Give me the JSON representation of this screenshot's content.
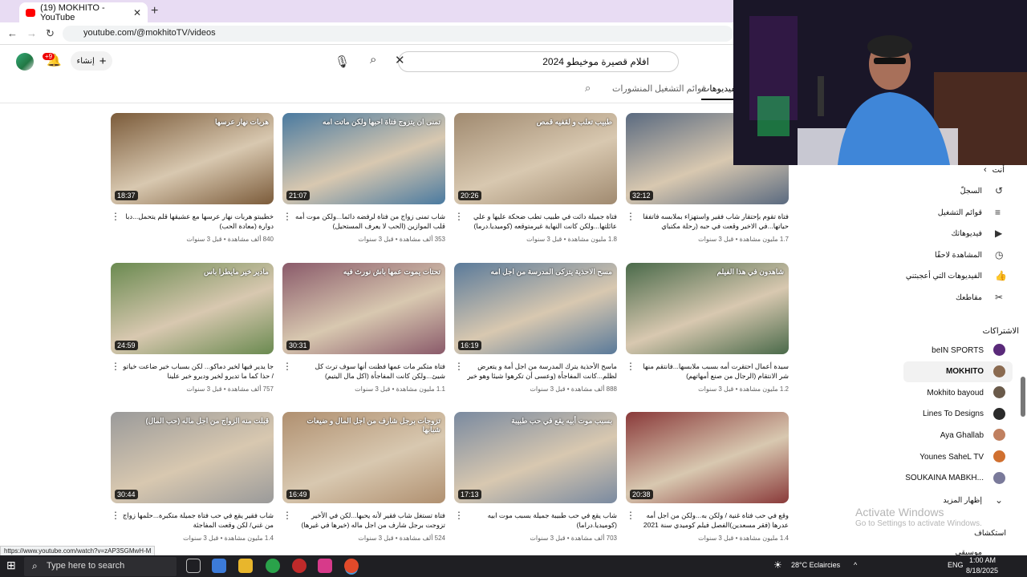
{
  "browser": {
    "tab_title": "(19) MOKHITO - YouTube",
    "url": "youtube.com/@mokhitoTV/videos",
    "status_url": "https://www.youtube.com/watch?v=zAP3SGMwH-M"
  },
  "header": {
    "search_value": "افلام قصيرة موخيطو 2024",
    "create_label": "إنشاء",
    "notif_badge": "+9"
  },
  "tabs": [
    "الفيديوهات",
    "قوائم التشغيل",
    "المنشورات"
  ],
  "videos": [
    {
      "thumb": "هربات نهار عرسها",
      "dur": "18:37",
      "title": "خطيبتو هربات نهار عرسها مع عشيقها قلم يتحمل...دبا دوارة (معادة الحب)",
      "meta": "840 ألف مشاهدة • قبل 3 سنوات",
      "c": "#7b5b3a"
    },
    {
      "thumb": "تمنى ان يتزوج فتاة احبها ولكن ماتت امه",
      "dur": "21:07",
      "title": "شاب تمنى زواج من فتاة لرفضه دائما...ولكن موت أمه قلب الموازين (الحب لا يعرف المستحيل)",
      "meta": "353 ألف مشاهدة • قبل 3 سنوات",
      "c": "#4a7aa0"
    },
    {
      "thumb": "طبيب تعلب و لقفيه قمص",
      "dur": "20:26",
      "title": "فتاة جميلة دائت في طبيب تطب ضحكة عليها و علي عائلتها...ولكن كانت النهاية غيرمتوقعه (كوميديا.درما)",
      "meta": "1.8 مليون مشاهدة • قبل 3 سنوات",
      "c": "#a08a70"
    },
    {
      "thumb": "",
      "dur": "32:12",
      "title": "فتاة تقوم بإحتقار شاب فقير واستهزاء بملابسه فاتفقا حياتها...في الاخير وقعت في حبه (رحلة مكتباي مكتشرا)",
      "meta": "1.7 مليون مشاهدة • قبل 3 سنوات",
      "c": "#5a6a80"
    },
    {
      "thumb": "مادير خير مايطرا باس",
      "dur": "24:59",
      "title": "جا يدير فيها لخير دماكو... لكن بسباب خير ضاعت خياتو / حذا كما ما تديرو لخير وديرو خير علينا",
      "meta": "757 ألف مشاهدة • قبل 3 سنوات",
      "c": "#6a8a50"
    },
    {
      "thumb": "تحتات يموت عمها باش نورث فيه",
      "dur": "30:31",
      "title": "فتاة متكبر مات عمها فظنت أنها سوف ترث كل شيئ...ولكن كانت المفاجأة (اكل مال اليتيم)",
      "meta": "1.1 مليون مشاهدة • قبل 3 سنوات",
      "c": "#8a5a6a"
    },
    {
      "thumb": "مسح الاحذية يتزكى المدرسة من اجل امه",
      "dur": "16:19",
      "title": "ماسح الأحذية يترك المدرسة من اجل أمة و يتعرض لظلم...كانت المفاجأة (وعسى أن تكرهوا شيئا وهو خير لكم)",
      "meta": "888 ألف مشاهدة • قبل 3 سنوات",
      "c": "#5a7a9a"
    },
    {
      "thumb": "شاهدون في هذا الفيلم",
      "dur": "",
      "title": "سيدة أعمال احتقرت أمه بسبب ملابسها...فانتقم منها شر الانتقام (الرجال من صنع أمهاتهم)",
      "meta": "1.2 مليون مشاهدة • قبل 3 سنوات",
      "c": "#4a6a4a"
    },
    {
      "thumb": "قبلت منه الزواج من اجل ماله (حب المال)",
      "dur": "30:44",
      "title": "شاب فقير يقع في حب فتاة جميلة متكبرة...حلمها زواج من غني/ لكن وقعت المفاجئة",
      "meta": "1.4 مليون مشاهدة • قبل 3 سنوات",
      "c": "#9a9a9a"
    },
    {
      "thumb": "تزوجات برجل شارف من اجل المال و ضيعات شبابها",
      "dur": "16:49",
      "title": "فتاة تستغل شاب فقير لأنه يحبها...لكن في الأخير تزوجت برجل شارف من اجل ماله (خيرها في غيرها)",
      "meta": "524 ألف مشاهدة • قبل 3 سنوات",
      "c": "#b09070"
    },
    {
      "thumb": "بسبب موت أبيه يقع في حب طبيبة",
      "dur": "17:13",
      "title": "شاب يقع في حب طبيبة جميلة بسبب موت ابيه (كوميديا.دراما)",
      "meta": "703 ألف مشاهدة • قبل 3 سنوات",
      "c": "#7a8aa0"
    },
    {
      "thumb": "",
      "dur": "20:38",
      "title": "وقع في حب فتاة غنية / ولكن به...ولكن من اجل أمه عدرها (فقر مسعدين)الفصل فيلم كوميدي سنة 2021",
      "meta": "1.4 مليون مشاهدة • قبل 3 سنوات",
      "c": "#8a3a3a"
    }
  ],
  "sidebar": {
    "you": "أنت",
    "items": [
      "السجلّ",
      "قوائم التشغيل",
      "فيديوهاتك",
      "المشاهدة لاحقًا",
      "الفيديوهات التي أعجبتني",
      "مقاطعك"
    ],
    "subs_title": "الاشتراكات",
    "subs": [
      {
        "name": "beIN SPORTS",
        "color": "#5a2a7a"
      },
      {
        "name": "MOKHITO",
        "color": "#8a6a50"
      },
      {
        "name": "Mokhito bayoud",
        "color": "#6a5a4a"
      },
      {
        "name": "Lines To Designs",
        "color": "#2a2a2a"
      },
      {
        "name": "Aya Ghallab",
        "color": "#c08060"
      },
      {
        "name": "Younes SaheL TV",
        "color": "#d07030"
      },
      {
        "name": "SOUKAINA MABKH...",
        "color": "#7a7a9a"
      }
    ],
    "show_more": "إظهار المزيد",
    "explore": "استكشاف",
    "music": "موسيقى"
  },
  "activate": {
    "line1": "Activate Windows",
    "line2": "Go to Settings to activate Windows."
  },
  "taskbar": {
    "search": "Type here to search",
    "weather": "28°C Eclaircies",
    "lang": "ENG",
    "time": "1:00 AM",
    "date": "8/18/2025"
  }
}
